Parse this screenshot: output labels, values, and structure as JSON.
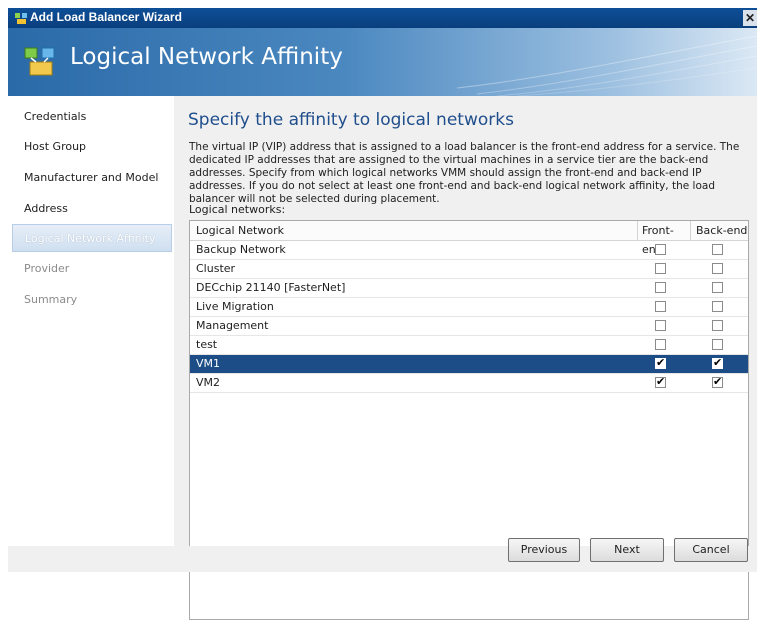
{
  "window": {
    "title": "Add Load Balancer Wizard",
    "close_glyph": "✕"
  },
  "banner": {
    "heading": "Logical Network Affinity"
  },
  "nav": {
    "items": [
      {
        "label": "Credentials",
        "state": "normal"
      },
      {
        "label": "Host Group",
        "state": "normal"
      },
      {
        "label": "Manufacturer and Model",
        "state": "normal"
      },
      {
        "label": "Address",
        "state": "normal"
      },
      {
        "label": "Logical Network Affinity",
        "state": "selected"
      },
      {
        "label": "Provider",
        "state": "disabled"
      },
      {
        "label": "Summary",
        "state": "disabled"
      }
    ]
  },
  "main": {
    "heading": "Specify the affinity to logical networks",
    "description": "The virtual IP (VIP) address that is assigned to a load balancer is the front-end address for a service. The dedicated IP addresses that are assigned to the virtual machines in a service tier are the back-end addresses. Specify from which logical networks VMM should assign the front-end and back-end IP addresses. If you do not select at least one front-end and back-end logical network affinity, the load balancer will not be selected during placement.",
    "list_label": "Logical networks:",
    "columns": {
      "name": "Logical Network",
      "front": "Front-end",
      "back": "Back-end"
    },
    "rows": [
      {
        "name": "Backup Network",
        "front": false,
        "back": false,
        "selected": false
      },
      {
        "name": "Cluster",
        "front": false,
        "back": false,
        "selected": false
      },
      {
        "name": "DECchip 21140 [FasterNet]",
        "front": false,
        "back": false,
        "selected": false
      },
      {
        "name": "Live Migration",
        "front": false,
        "back": false,
        "selected": false
      },
      {
        "name": "Management",
        "front": false,
        "back": false,
        "selected": false
      },
      {
        "name": "test",
        "front": false,
        "back": false,
        "selected": false
      },
      {
        "name": "VM1",
        "front": true,
        "back": true,
        "selected": true
      },
      {
        "name": "VM2",
        "front": true,
        "back": true,
        "selected": false
      }
    ]
  },
  "footer": {
    "previous_label": "Previous",
    "next_label": "Next",
    "cancel_label": "Cancel"
  },
  "colors": {
    "accent": "#1c4d87",
    "heading": "#1f4e8c",
    "titlebar": "#0e4f97"
  },
  "icons": {
    "app": "network-wizard-icon",
    "banner": "network-icon",
    "check": "✔"
  }
}
